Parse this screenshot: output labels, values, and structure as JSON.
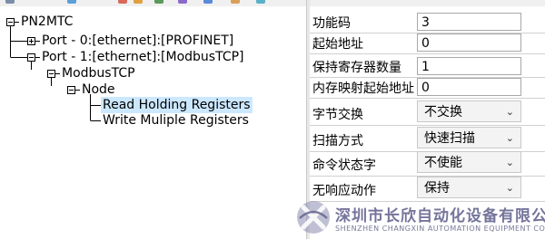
{
  "tree": {
    "root": "PN2MTC",
    "port0": "Port - 0:[ethernet]:[PROFINET]",
    "port1": "Port - 1:[ethernet]:[ModbusTCP]",
    "modbus": "ModbusTCP",
    "node": "Node",
    "cmd_read": "Read Holding Registers",
    "cmd_write": "Write Muliple Registers",
    "selected": "Read Holding Registers"
  },
  "props": [
    {
      "label": "功能码",
      "value": "3",
      "kind": "text"
    },
    {
      "label": "起始地址",
      "value": "0",
      "kind": "text"
    },
    {
      "label": "保持寄存器数量",
      "value": "1",
      "kind": "text"
    },
    {
      "label": "内存映射起始地址",
      "value": "0",
      "kind": "text"
    },
    {
      "label": "字节交换",
      "value": "不交换",
      "kind": "select"
    },
    {
      "label": "扫描方式",
      "value": "快速扫描",
      "kind": "select"
    },
    {
      "label": "命令状态字",
      "value": "不使能",
      "kind": "select"
    },
    {
      "label": "无响应动作",
      "value": "保持",
      "kind": "select"
    }
  ],
  "watermark": {
    "name": "深圳市长欣自动化设备有限公司",
    "name_en": "SHENZHEN CHANGXIN AUTOMATION EQUIPMENT CO., LTD."
  },
  "colors": {
    "selection": "#cce8ff",
    "watermark": "#5c5c8a"
  }
}
